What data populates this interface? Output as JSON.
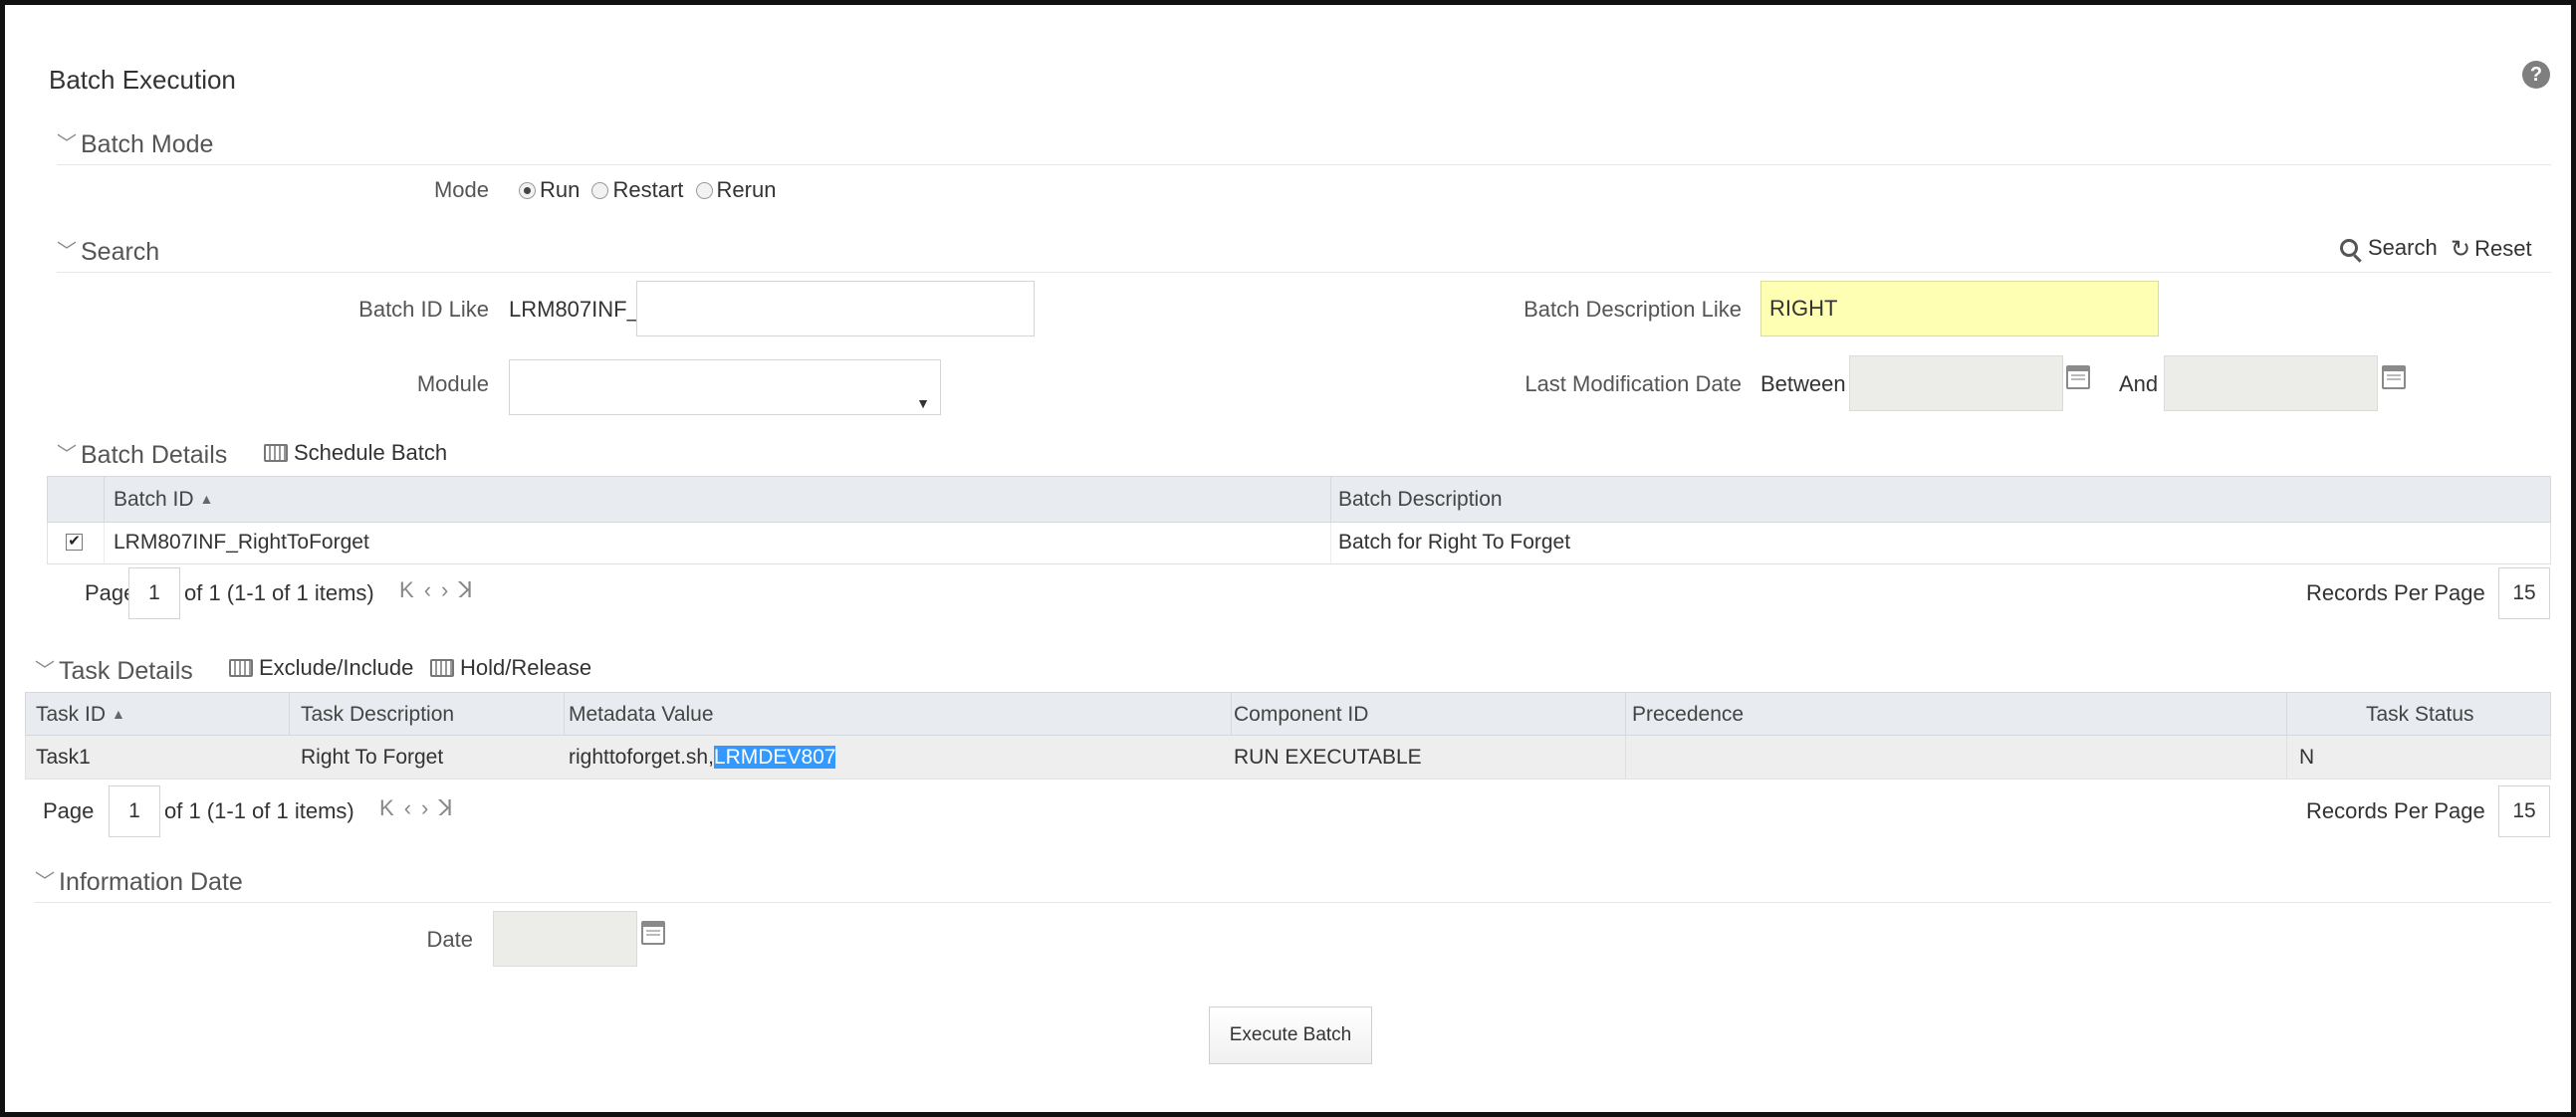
{
  "page": {
    "title": "Batch Execution",
    "help_icon_glyph": "?"
  },
  "batch_mode": {
    "header": "Batch Mode",
    "mode_label": "Mode",
    "options": [
      "Run",
      "Restart",
      "Rerun"
    ],
    "selected": "Run"
  },
  "search": {
    "header": "Search",
    "search_label": "Search",
    "reset_label": "Reset",
    "batch_id_label": "Batch ID Like",
    "batch_id_value": "LRM807INF_",
    "batch_desc_label": "Batch Description Like",
    "batch_desc_value": "RIGHT",
    "module_label": "Module",
    "module_value": "",
    "last_mod_label": "Last Modification Date",
    "between_label": "Between",
    "and_label": "And",
    "from_date": "",
    "to_date": ""
  },
  "batch_details": {
    "header": "Batch Details",
    "schedule_label": "Schedule Batch",
    "columns": [
      "Batch ID",
      "Batch Description"
    ],
    "rows": [
      {
        "batch_id": "LRM807INF_RightToForget",
        "description": "Batch for Right To Forget",
        "checked": true
      }
    ],
    "pager": {
      "page_label": "Page",
      "page_value": "1",
      "of_text": "of 1 (1-1 of 1 items)",
      "records_label": "Records Per Page",
      "records_value": "15"
    }
  },
  "task_details": {
    "header": "Task Details",
    "exclude_label": "Exclude/Include",
    "hold_label": "Hold/Release",
    "columns": [
      "Task ID",
      "Task Description",
      "Metadata Value",
      "Component ID",
      "Precedence",
      "Task Status"
    ],
    "rows": [
      {
        "task_id": "Task1",
        "description": "Right To Forget",
        "metadata_prefix": "righttoforget.sh,",
        "metadata_highlight": "LRMDEV807",
        "component_id": "RUN EXECUTABLE",
        "precedence": "",
        "status": "N"
      }
    ],
    "pager": {
      "page_label": "Page",
      "page_value": "1",
      "of_text": "of 1 (1-1 of 1 items)",
      "records_label": "Records Per Page",
      "records_value": "15"
    }
  },
  "information_date": {
    "header": "Information Date",
    "date_label": "Date",
    "date_value": ""
  },
  "actions": {
    "execute_label": "Execute Batch"
  },
  "colors": {
    "highlight": "#3399ff",
    "yellow_input": "#ffffb3",
    "header_bg": "#e8ebef"
  }
}
